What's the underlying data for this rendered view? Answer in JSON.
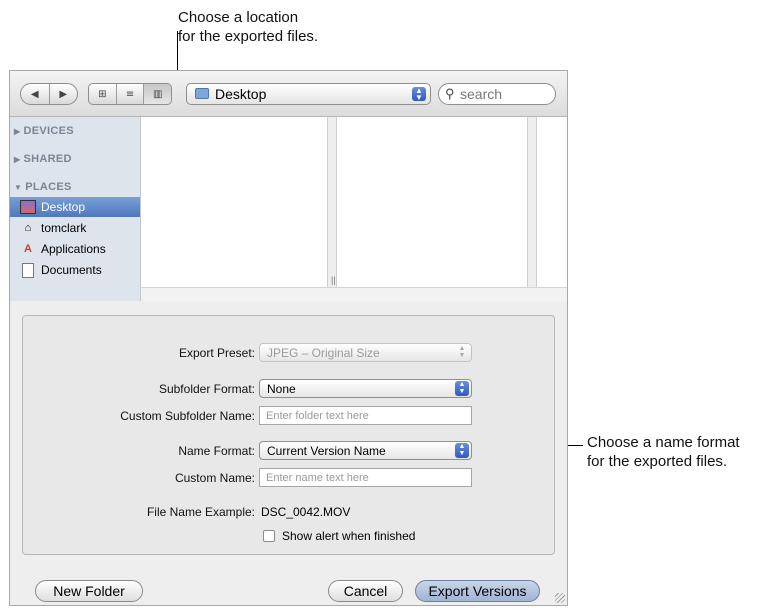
{
  "callouts": {
    "top_line1": "Choose a location",
    "top_line2": "for the exported files.",
    "right_line1": "Choose a name format",
    "right_line2": "for the exported files."
  },
  "toolbar": {
    "back_glyph": "◀",
    "forward_glyph": "▶",
    "view_icon_glyph": "⊞",
    "view_list_glyph": "≡",
    "view_column_glyph": "▥",
    "location": "Desktop",
    "search_placeholder": "search"
  },
  "sidebar": {
    "sections": [
      "DEVICES",
      "SHARED",
      "PLACES"
    ],
    "items": [
      {
        "label": "Desktop",
        "icon": "desktop-icon",
        "selected": true
      },
      {
        "label": "tomclark",
        "icon": "home-icon",
        "selected": false
      },
      {
        "label": "Applications",
        "icon": "applications-icon",
        "selected": false
      },
      {
        "label": "Documents",
        "icon": "documents-icon",
        "selected": false
      }
    ]
  },
  "form": {
    "export_preset_label": "Export Preset:",
    "export_preset_value": "JPEG – Original Size",
    "subfolder_format_label": "Subfolder Format:",
    "subfolder_format_value": "None",
    "custom_subfolder_label": "Custom Subfolder Name:",
    "custom_subfolder_placeholder": "Enter folder text here",
    "name_format_label": "Name Format:",
    "name_format_value": "Current Version Name",
    "custom_name_label": "Custom Name:",
    "custom_name_placeholder": "Enter name text here",
    "file_name_example_label": "File Name Example:",
    "file_name_example_value": "DSC_0042.MOV",
    "show_alert_label": "Show alert when finished"
  },
  "buttons": {
    "new_folder": "New Folder",
    "cancel": "Cancel",
    "export_versions": "Export Versions"
  }
}
